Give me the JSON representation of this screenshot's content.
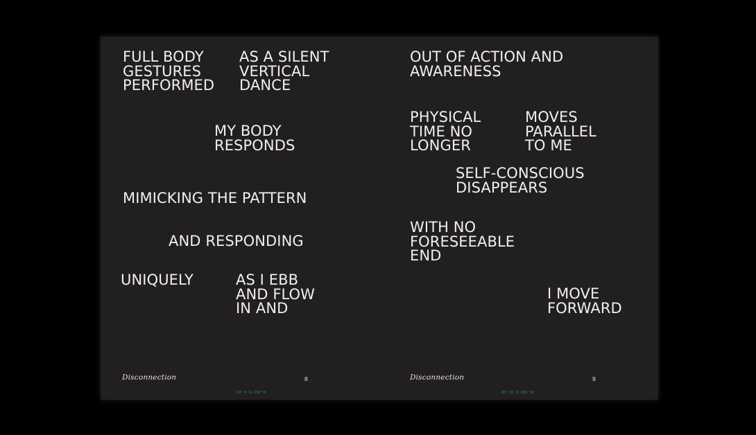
{
  "left_page": {
    "blocks": [
      "FULL BODY\nGESTURES\nPERFORMED",
      "AS A SILENT\nVERTICAL\nDANCE",
      "MY BODY\nRESPONDS",
      "MIMICKING THE PATTERN",
      "AND RESPONDING",
      "UNIQUELY",
      "AS I EBB\nAND FLOW\nIN AND"
    ],
    "footer_title": "Disconnection",
    "page_number": "8",
    "coordinate": "53° 4' 11.336\" N"
  },
  "right_page": {
    "blocks": [
      "OUT OF ACTION AND\nAWARENESS",
      "PHYSICAL\nTIME NO\nLONGER",
      "MOVES\nPARALLEL\nTO ME",
      "SELF-CONSCIOUS\nDISAPPEARS",
      "WITH NO\nFORESEEABLE\nEND",
      "I MOVE\nFORWARD"
    ],
    "footer_title": "Disconnection",
    "page_number": "9",
    "coordinate": "85° 18' 11.336\" W"
  },
  "colors": {
    "background": "#000000",
    "page": "#221f20",
    "text": "#f2f0ee",
    "coordinate": "#2f8a6a"
  }
}
